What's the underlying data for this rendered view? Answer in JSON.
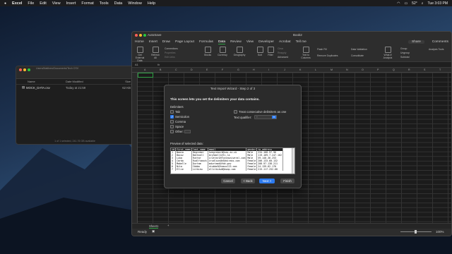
{
  "menubar": {
    "apple": "",
    "app": "Excel",
    "items": [
      "File",
      "Edit",
      "View",
      "Insert",
      "Format",
      "Tools",
      "Data",
      "Window",
      "Help"
    ],
    "status_right": [
      "52°",
      "Tue 3:03 PM"
    ]
  },
  "finder": {
    "path": "Users/Matthew/Documents/Tech CSV",
    "columns": [
      "Name",
      "Date Modified",
      "Size"
    ],
    "file": {
      "name": "MOCK_DATA.csv",
      "date": "Today at 21:59",
      "size": "62 KB"
    },
    "status": "1 of 1 selected, 241.76 GB available"
  },
  "excel": {
    "autosave": "AutoSave",
    "book": "Book2",
    "tabs": [
      "Home",
      "Insert",
      "Draw",
      "Page Layout",
      "Formulas",
      "Data",
      "Review",
      "View",
      "Developer",
      "Acrobat",
      "Tell me"
    ],
    "active_tab": "Data",
    "share": "Share",
    "comments": "Comments",
    "ribbon": {
      "get_external": "Get External Data",
      "refresh": "Refresh All",
      "connections": "Connections",
      "properties": "Properties",
      "edit_links": "Edit Links",
      "stocks": "Stocks",
      "currency": "Currency",
      "geography": "Geography",
      "sort": "Sort",
      "filter": "Filter",
      "clear": "Clear",
      "reapply": "Reapply",
      "advanced": "Advanced",
      "text_to_columns": "Text to Columns",
      "flash_fill": "Flash Fill",
      "remove_duplicates": "Remove Duplicates",
      "data_validation": "Data Validation",
      "consolidate": "Consolidate",
      "what_if": "What-If Analysis",
      "group": "Group",
      "ungroup": "Ungroup",
      "subtotal": "Subtotal",
      "analysis_tools": "Analysis Tools"
    },
    "namebox": "A1",
    "formula_fx": "fx",
    "columns": [
      "A",
      "B",
      "C",
      "D",
      "E",
      "F",
      "G",
      "H",
      "I",
      "J",
      "K",
      "L",
      "M",
      "N",
      "O",
      "P",
      "Q",
      "R",
      "S",
      "T"
    ],
    "sheet_tab": "Sheet1",
    "add_sheet": "+",
    "status_ready": "Ready",
    "zoom": "100%"
  },
  "dialog": {
    "title": "Text Import Wizard - Step 2 of 3",
    "instruction": "This screen lets you set the delimiters your data contains.",
    "delimiters_label": "Delimiters",
    "options": [
      {
        "label": "Tab",
        "checked": false
      },
      {
        "label": "Semicolon",
        "checked": true
      },
      {
        "label": "Comma",
        "checked": false
      },
      {
        "label": "Space",
        "checked": false
      },
      {
        "label": "Other:",
        "checked": false
      }
    ],
    "consecutive": "Treat consecutive delimiters as one",
    "qualifier_label": "Text qualifier:",
    "qualifier_value": "\"",
    "preview_label": "Preview of selected data:",
    "preview_rows": [
      [
        "id",
        "first_name",
        "last_name",
        "email",
        "gender",
        "ip_address"
      ],
      [
        "1",
        "Naoia",
        "Hegreber",
        "hvegreber0@nas.ac.uk",
        "Male",
        "234.168.97.96"
      ],
      [
        "2",
        "Bacoz",
        "Bathnell",
        "bryhbell1@fc.la",
        "Male",
        "119.169.7.247.162"
      ],
      [
        "3",
        "Luka",
        "Ruttar",
        "iruttar2@fcalmuniveral.com",
        "Male",
        "59.140.36.253"
      ],
      [
        "4",
        "Cardo",
        "Rudlfsmock",
        "crudlsonde3@diraks.com",
        "Female",
        "206.133.60.132"
      ],
      [
        "5",
        "Mabelle",
        "Durtam",
        "mdurtam4@fda.gov",
        "Female",
        "208.97.138.211"
      ],
      [
        "6",
        "Nita",
        "Ibbba",
        "ntubbe5@hnews123.com",
        "Female",
        "24.139.82.170"
      ],
      [
        "7",
        "Ellie",
        "Litkiew",
        "ellitkiew6@msap.com",
        "Female",
        "215.117.252.68"
      ]
    ],
    "buttons": {
      "cancel": "Cancel",
      "back": "< Back",
      "next": "Next >",
      "finish": "Finish"
    }
  },
  "colors": {
    "accent": "#2d7bf0",
    "excel_green": "#2ea043"
  }
}
